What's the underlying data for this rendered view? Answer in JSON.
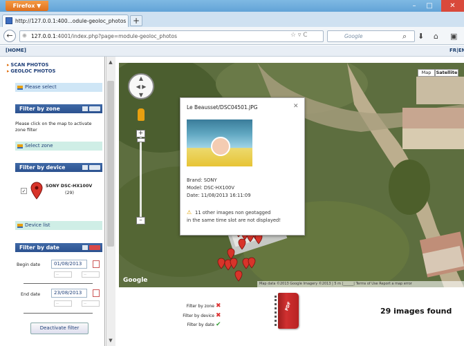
{
  "browser": {
    "menu_button": "Firefox ▼",
    "tab_title": "http://127.0.0.1:400...odule-geoloc_photos",
    "new_tab": "+",
    "url_host": "127.0.0.1",
    "url_rest": ":4001/index.php?page=module-geoloc_photos",
    "search_placeholder": "Google",
    "window_buttons": {
      "minimize": "–",
      "maximize": "□",
      "close": "✕"
    }
  },
  "topbar": {
    "home": "[HOME]",
    "lang": "FR|EN"
  },
  "sidebar": {
    "menu_links": [
      "SCAN PHOTOS",
      "GEOLOC PHOTOS"
    ],
    "please_select": "Please select",
    "zone": {
      "title": "Filter by zone",
      "help": "Please click on the map to activate zone filter",
      "action": "Select zone"
    },
    "device": {
      "title": "Filter by device",
      "name": "SONY DSC-HX100V",
      "count": "(29)",
      "checked": true,
      "action": "Device list"
    },
    "date": {
      "title": "Filter by date",
      "begin_label": "Begin date",
      "begin_value": "01/08/2013",
      "end_label": "End date",
      "end_value": "23/08/2013",
      "time_placeholder": "--",
      "button": "Deactivate filter"
    }
  },
  "map": {
    "type_map": "Map",
    "type_satellite": "Satellite",
    "zoom_in": "+",
    "zoom_out": "–",
    "logo": "Google",
    "footer": "Map data ©2013 Google Imagery ©2013 | 5 m |______| Terms of Use Report a map error",
    "popup": {
      "title": "Le Beausset/DSC04501.JPG",
      "close": "✕",
      "brand": "Brand: SONY",
      "model": "Model: DSC-HX100V",
      "date": "Date: 11/08/2013 16:11:09",
      "warning_line1": "11 other images non geotagged",
      "warning_line2": "in the same time slot are not displayed!"
    }
  },
  "results": {
    "filters": [
      {
        "label": "Filter by zone",
        "active": false
      },
      {
        "label": "Filter by device",
        "active": false
      },
      {
        "label": "Filter by date",
        "active": true
      }
    ],
    "found": "29 images found"
  },
  "colors": {
    "panel_header": "#2c5290",
    "select_bar": "#cfe6f6",
    "action_bar": "#cfeee6",
    "marker": "#d8342a"
  }
}
